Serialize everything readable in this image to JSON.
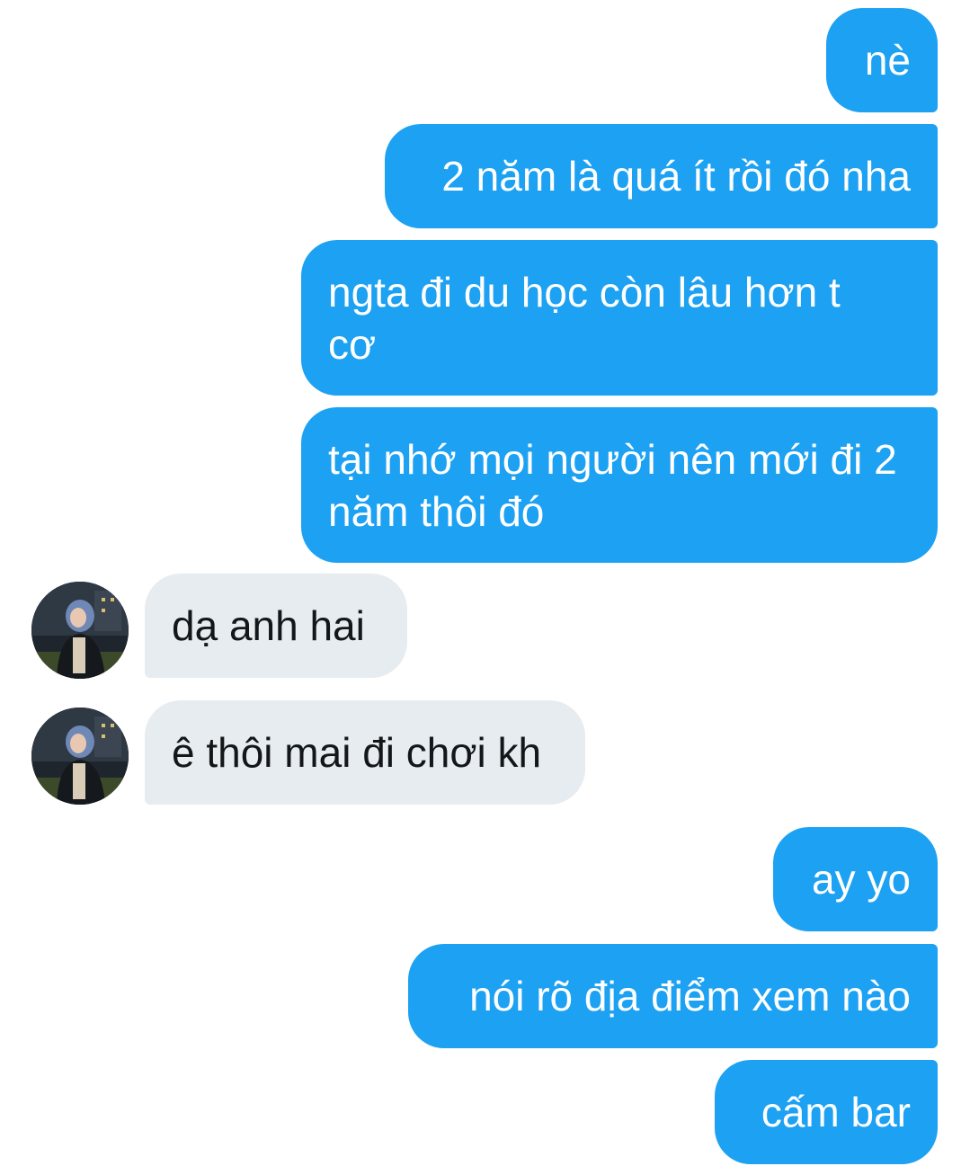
{
  "conversation": {
    "messages": [
      {
        "id": "m1",
        "direction": "sent",
        "text": "nè"
      },
      {
        "id": "m2",
        "direction": "sent",
        "text": "2 năm là quá ít rồi đó nha"
      },
      {
        "id": "m3",
        "direction": "sent",
        "text": "ngta đi du học còn lâu hơn t cơ"
      },
      {
        "id": "m4",
        "direction": "sent",
        "text": "tại nhớ mọi người nên mới đi 2 năm thôi đó"
      },
      {
        "id": "m5",
        "direction": "received",
        "text": "dạ anh hai"
      },
      {
        "id": "m6",
        "direction": "received",
        "text": "ê thôi mai đi chơi kh"
      },
      {
        "id": "m7",
        "direction": "sent",
        "text": "ay yo"
      },
      {
        "id": "m8",
        "direction": "sent",
        "text": "nói rõ địa điểm xem nào"
      },
      {
        "id": "m9",
        "direction": "sent",
        "text": "cấm bar"
      }
    ]
  },
  "colors": {
    "sent_bubble": "#1da1f2",
    "sent_text": "#ffffff",
    "received_bubble": "#e6ecf0",
    "received_text": "#14171a",
    "background": "#ffffff"
  },
  "icons": {
    "contact_avatar": "avatar-photo"
  }
}
